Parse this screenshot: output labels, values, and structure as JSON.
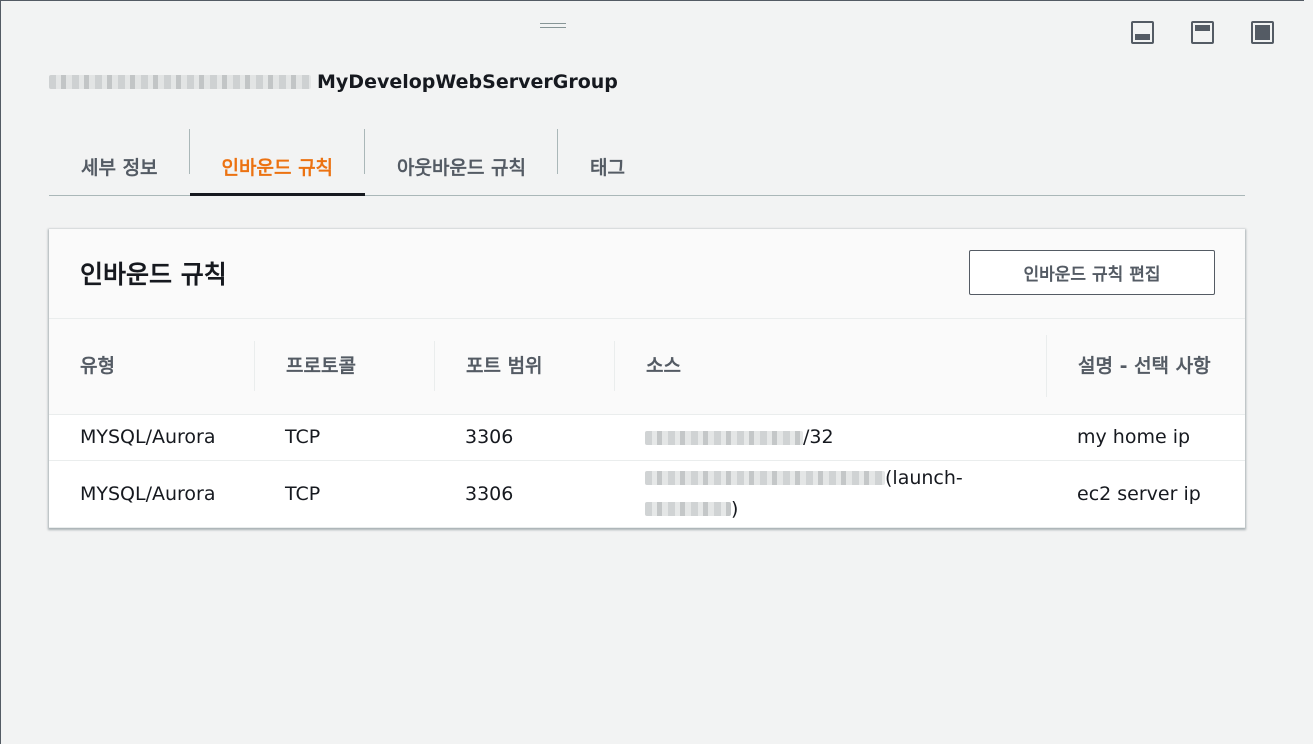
{
  "window": {
    "title": "MyDevelopWebServerGroup"
  },
  "tabs": [
    {
      "label": "세부 정보",
      "active": false
    },
    {
      "label": "인바운드 규칙",
      "active": true
    },
    {
      "label": "아웃바운드 규칙",
      "active": false
    },
    {
      "label": "태그",
      "active": false
    }
  ],
  "panel": {
    "title": "인바운드 규칙",
    "edit_button": "인바운드 규칙 편집"
  },
  "table": {
    "columns": [
      "유형",
      "프로토콜",
      "포트 범위",
      "소스",
      "설명 - 선택 사항"
    ],
    "rows": [
      {
        "type": "MYSQL/Aurora",
        "protocol": "TCP",
        "port": "3306",
        "source_suffix": "/32",
        "description": "my home ip"
      },
      {
        "type": "MYSQL/Aurora",
        "protocol": "TCP",
        "port": "3306",
        "source_suffix": "(launch-",
        "source_suffix2": ")",
        "description": "ec2 server ip"
      }
    ]
  },
  "colors": {
    "accent": "#ec7211",
    "text": "#16191f",
    "muted": "#545b64",
    "background": "#f2f3f3"
  }
}
